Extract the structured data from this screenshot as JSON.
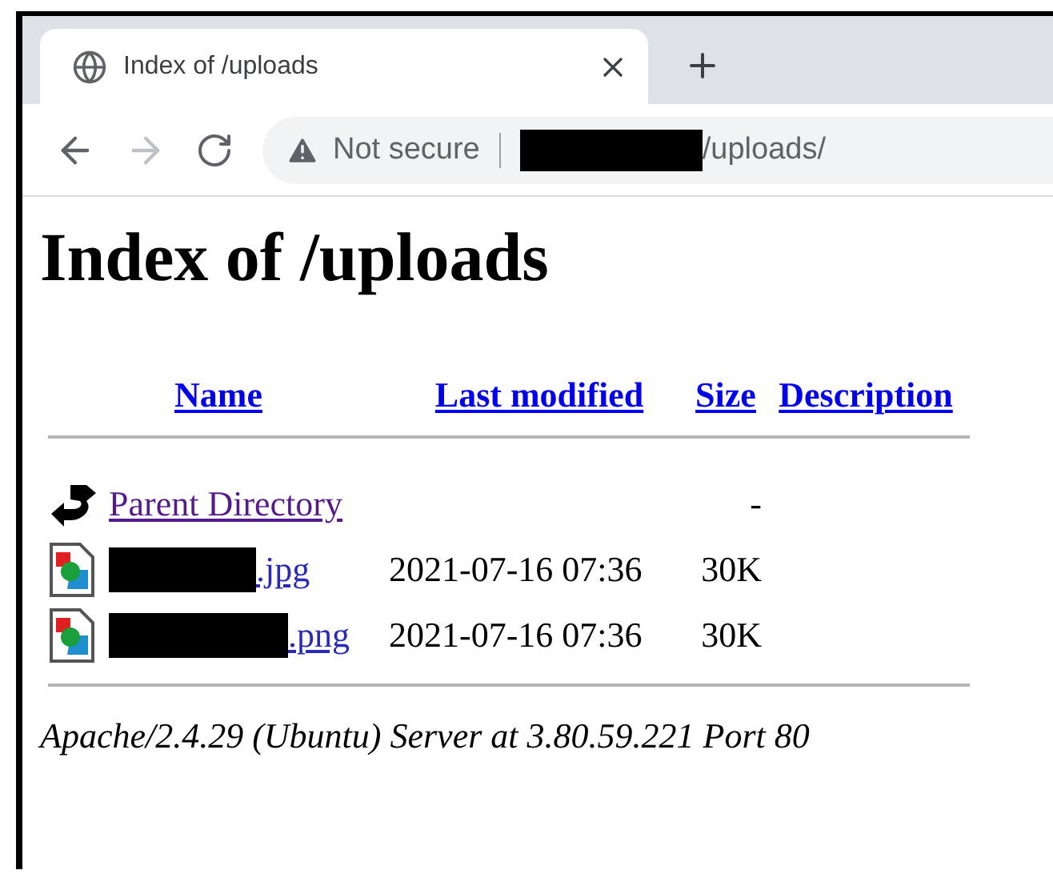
{
  "browser": {
    "tab": {
      "title": "Index of /uploads",
      "selected": true
    },
    "address_bar": {
      "security_label": "Not secure",
      "url_redacted": true,
      "url_path": "/uploads/"
    }
  },
  "page": {
    "heading": "Index of /uploads",
    "columns": [
      {
        "label": "Name"
      },
      {
        "label": "Last modified"
      },
      {
        "label": "Size"
      },
      {
        "label": "Description"
      }
    ],
    "rows": [
      {
        "kind": "parent",
        "name": "Parent Directory",
        "visited": true,
        "size": "-"
      },
      {
        "kind": "image",
        "redacted": true,
        "name": ".jpg",
        "visited": false,
        "last_modified": "2021-07-16 07:36",
        "size": "30K"
      },
      {
        "kind": "image",
        "redacted": true,
        "name": ".png",
        "visited": false,
        "last_modified": "2021-07-16 07:36",
        "size": "30K"
      }
    ],
    "footer": "Apache/2.4.29 (Ubuntu) Server at 3.80.59.221 Port 80"
  }
}
